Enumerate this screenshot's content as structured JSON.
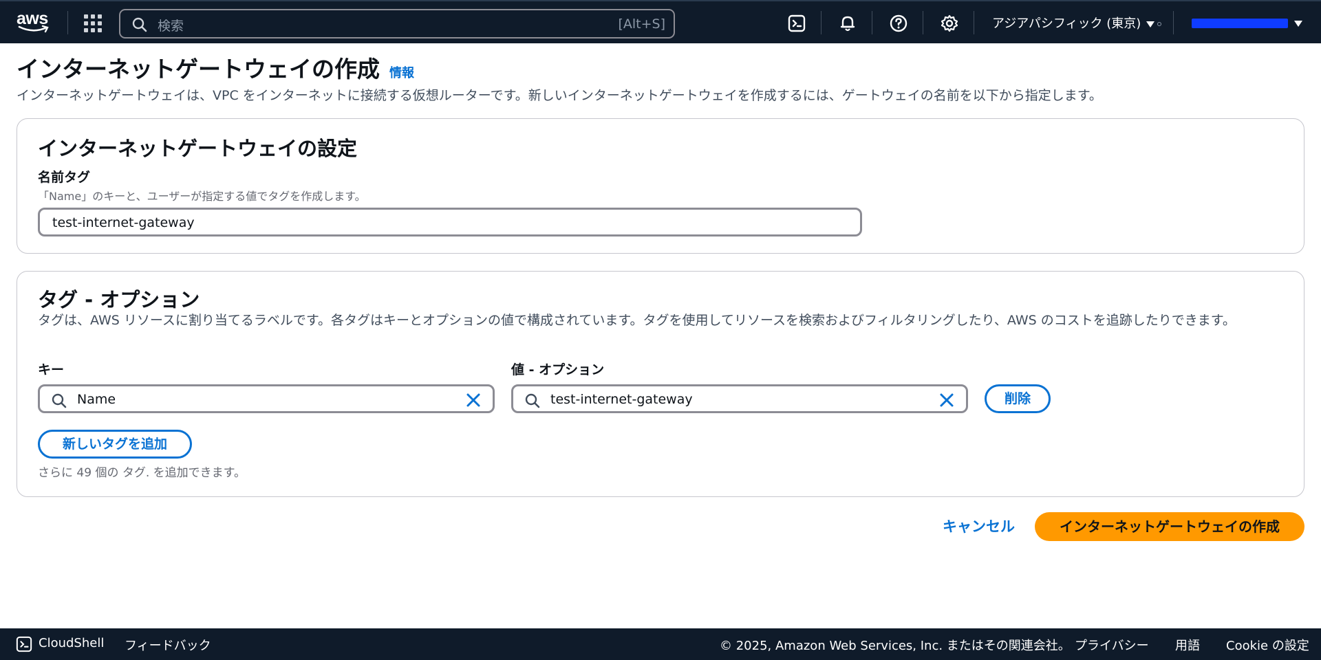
{
  "topnav": {
    "logo_text": "aws",
    "search_placeholder": "検索",
    "search_shortcut": "[Alt+S]",
    "region_label": "アジアパシフィック (東京)",
    "icons": [
      "apps-grid-icon",
      "search-icon",
      "cloudshell-icon",
      "bell-icon",
      "help-icon",
      "gear-icon"
    ]
  },
  "page": {
    "title": "インターネットゲートウェイの作成",
    "info_link": "情報",
    "description": "インターネットゲートウェイは、VPC をインターネットに接続する仮想ルーターです。新しいインターネットゲートウェイを作成するには、ゲートウェイの名前を以下から指定します。"
  },
  "settings": {
    "heading": "インターネットゲートウェイの設定",
    "name_tag_label": "名前タグ",
    "name_tag_desc": "「Name」のキーと、ユーザーが指定する値でタグを作成します。",
    "name_tag_value": "test-internet-gateway"
  },
  "tags": {
    "heading": "タグ - オプション",
    "description": "タグは、AWS リソースに割り当てるラベルです。各タグはキーとオプションの値で構成されています。タグを使用してリソースを検索およびフィルタリングしたり、AWS のコストを追跡したりできます。",
    "key_label": "キー",
    "value_label": "値 - オプション",
    "rows": [
      {
        "key": "Name",
        "value": "test-internet-gateway",
        "remove_label": "削除"
      }
    ],
    "add_button": "新しいタグを追加",
    "limit_text": "さらに 49 個の タグ. を追加できます。"
  },
  "actions": {
    "cancel": "キャンセル",
    "create": "インターネットゲートウェイの作成"
  },
  "footer": {
    "cloudshell": "CloudShell",
    "feedback": "フィードバック",
    "copyright": "© 2025, Amazon Web Services, Inc. またはその関連会社。",
    "privacy": "プライバシー",
    "terms": "用語",
    "cookie": "Cookie の設定"
  },
  "colors": {
    "nav_bg": "#0f1b2a",
    "link": "#0972d3",
    "primary_button": "#ff9900"
  }
}
